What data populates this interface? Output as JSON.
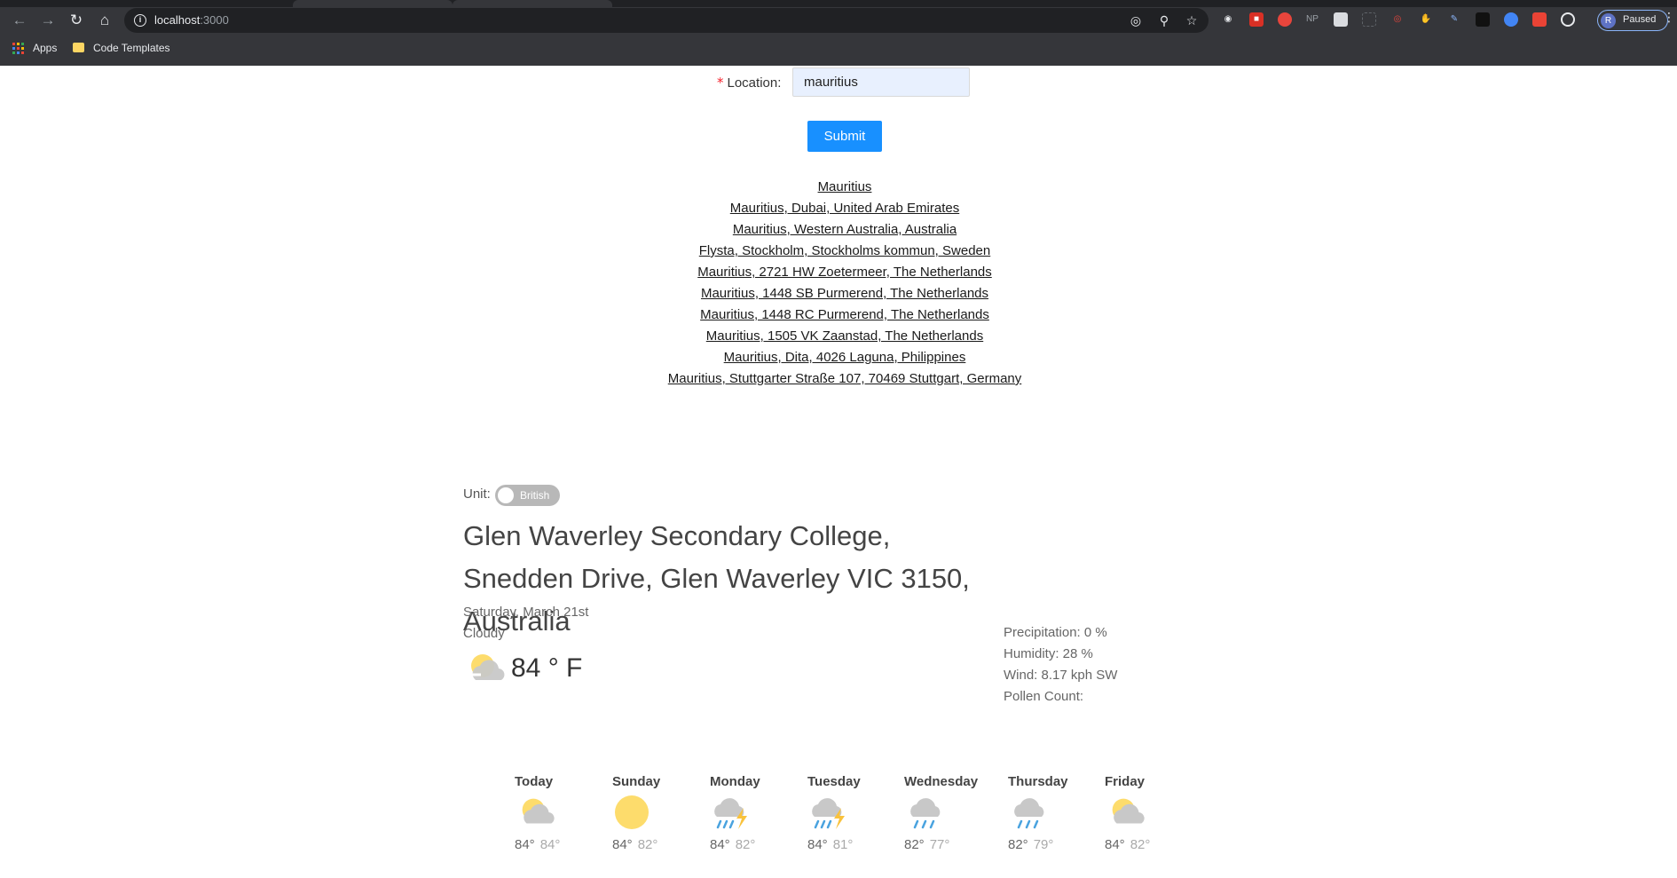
{
  "browser": {
    "url_host": "localhost",
    "url_port": ":3000",
    "bookmarks": [
      "Apps",
      "Code Templates"
    ],
    "profile_initial": "R",
    "profile_status": "Paused",
    "np_label": "NP"
  },
  "form": {
    "location_label": "Location",
    "location_colon": ":",
    "required_mark": "*",
    "location_value": "mauritius",
    "submit_label": "Submit"
  },
  "suggestions": [
    "Mauritius",
    "Mauritius, Dubai, United Arab Emirates",
    "Mauritius, Western Australia, Australia",
    "Flysta, Stockholm, Stockholms kommun, Sweden",
    "Mauritius, 2721 HW Zoetermeer, The Netherlands",
    "Mauritius, 1448 SB Purmerend, The Netherlands",
    "Mauritius, 1448 RC Purmerend, The Netherlands",
    "Mauritius, 1505 VK Zaanstad, The Netherlands",
    "Mauritius, Dita, 4026 Laguna, Philippines",
    "Mauritius, Stuttgarter Straße 107, 70469 Stuttgart, Germany"
  ],
  "weather": {
    "unit_label": "Unit:",
    "unit_toggle_label": "British",
    "place": "Glen Waverley Secondary College, Snedden Drive, Glen Waverley VIC 3150, Australia",
    "date": "Saturday, March 21st",
    "condition": "Cloudy",
    "condition_icon": "partly-cloudy-icon",
    "temperature": "84 ° F",
    "details": {
      "precipitation": "Precipitation: 0 %",
      "humidity": "Humidity: 28 %",
      "wind": "Wind: 8.17 kph SW",
      "pollen": "Pollen Count:"
    },
    "forecast": [
      {
        "day": "Today",
        "icon": "partly-cloudy-icon",
        "hi": "84°",
        "lo": "84°"
      },
      {
        "day": "Sunday",
        "icon": "sun-icon",
        "hi": "84°",
        "lo": "82°"
      },
      {
        "day": "Monday",
        "icon": "thunderstorm-icon",
        "hi": "84°",
        "lo": "82°"
      },
      {
        "day": "Tuesday",
        "icon": "thunderstorm-icon",
        "hi": "84°",
        "lo": "81°"
      },
      {
        "day": "Wednesday",
        "icon": "rain-icon",
        "hi": "82°",
        "lo": "77°"
      },
      {
        "day": "Thursday",
        "icon": "rain-icon",
        "hi": "82°",
        "lo": "79°"
      },
      {
        "day": "Friday",
        "icon": "partly-cloudy-icon",
        "hi": "84°",
        "lo": "82°"
      }
    ]
  },
  "colors": {
    "accent": "#1890ff",
    "sun": "#fddc6c",
    "cloud": "#c8c8c8",
    "rain": "#4aa3df",
    "bolt": "#f9c23c"
  }
}
